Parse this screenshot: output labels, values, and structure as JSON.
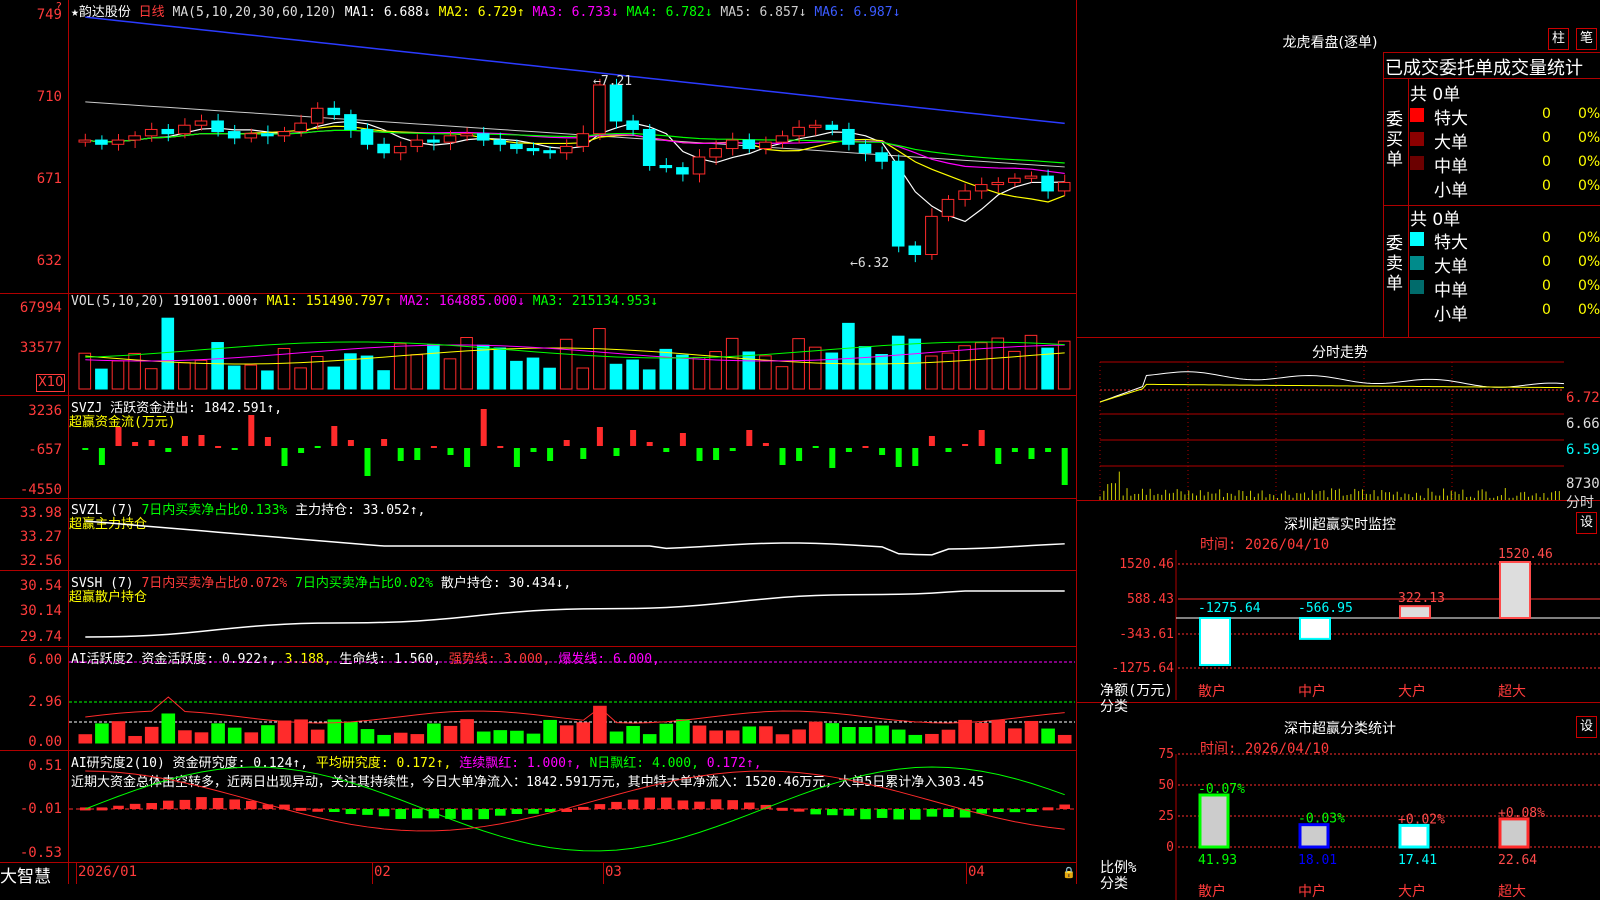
{
  "stock": {
    "name": "★韵达股份",
    "period": "日线"
  },
  "kline": {
    "legend": {
      "ma_label": "MA(5,10,20,30,60,120)",
      "ma1": "MA1: 6.688↓",
      "ma2": "MA2: 6.729↑",
      "ma3": "MA3: 6.733↓",
      "ma4": "MA4: 6.782↓",
      "ma5": "MA5: 6.857↓",
      "ma6": "MA6: 6.987↓"
    },
    "y_ticks": [
      "749",
      "710",
      "671",
      "632"
    ],
    "high_note": "7.21",
    "low_note": "6.32"
  },
  "vol": {
    "label": "VOL(5,10,20)",
    "val": "191001.000↑",
    "ma1": "MA1: 151490.797↑",
    "ma2": "MA2: 164885.000↓",
    "ma3": "MA3: 215134.953↓",
    "y_ticks": [
      "67994",
      "33577"
    ],
    "unit": "X10"
  },
  "svzj": {
    "label": "SVZJ  活跃资金进出: 1842.591↑,",
    "sub": "超赢资金流(万元)",
    "y_ticks": [
      "3236",
      "-657",
      "-4550"
    ]
  },
  "svzl": {
    "label": "SVZL (7)",
    "t1": "7日内买卖净占比0.133%",
    "t2": "主力持仓: 33.052↑,",
    "sub": "超赢主力持仓",
    "y_ticks": [
      "33.98",
      "33.27",
      "32.56"
    ]
  },
  "svsh": {
    "label": "SVSH (7)",
    "t1": "7日内买卖净占比0.072%",
    "t2": "7日内买卖净占比0.02%",
    "t3": "散户持仓: 30.434↓,",
    "sub": "超赢散户持仓",
    "y_ticks": [
      "30.54",
      "30.14",
      "29.74"
    ]
  },
  "ai1": {
    "label": "AI活跃度2",
    "t1": "资金活跃度: 0.922↑,",
    "t2": "3.188,",
    "t3": "生命线: 1.560,",
    "t4": "强势线: 3.000,",
    "t5": "爆发线: 6.000,",
    "y_ticks": [
      "6.00",
      "2.96",
      "0.00"
    ]
  },
  "ai2": {
    "label": "AI研究度2(10)",
    "t1": "资金研究度: 0.124↑,",
    "t2": "平均研究度: 0.172↑,",
    "t3": "连续飘红: 1.000↑,",
    "t4": "N日飘红: 4.000,",
    "t5": "0.172↑,",
    "note": "近期大资金总体由空转多，近两日出现异动，关注其持续性，今日大单净流入：1842.591万元，其中特大单净流入：1520.46万元，大单5日累计净入303.45",
    "y_ticks": [
      "0.51",
      "-0.01",
      "-0.53"
    ]
  },
  "x_axis": {
    "labels": [
      "2026/01",
      "02",
      "03",
      "04"
    ]
  },
  "brand": "大智慧",
  "dragon": {
    "title": "龙虎看盘(逐单)",
    "btn1": "柱",
    "btn2": "笔",
    "tabs": "已成交委托单成交量统计",
    "buy": {
      "side": "委买单",
      "total": "共 0单",
      "rows": [
        {
          "name": "特大",
          "n": "0",
          "p": "0%",
          "color": "#ff0000"
        },
        {
          "name": "大单",
          "n": "0",
          "p": "0%",
          "color": "#8b0000"
        },
        {
          "name": "中单",
          "n": "0",
          "p": "0%",
          "color": "#6b0000"
        },
        {
          "name": "小单",
          "n": "0",
          "p": "0%",
          "color": ""
        }
      ]
    },
    "sell": {
      "side": "委卖单",
      "total": "共 0单",
      "rows": [
        {
          "name": "特大",
          "n": "0",
          "p": "0%",
          "color": "#00ffff"
        },
        {
          "name": "大单",
          "n": "0",
          "p": "0%",
          "color": "#008b8b"
        },
        {
          "name": "中单",
          "n": "0",
          "p": "0%",
          "color": "#006b6b"
        },
        {
          "name": "小单",
          "n": "0",
          "p": "0%",
          "color": ""
        }
      ]
    }
  },
  "intraday": {
    "title": "分时走势",
    "y_ticks": [
      "6.72",
      "6.66",
      "6.59",
      "8730"
    ],
    "unit": "分时"
  },
  "sz_monitor": {
    "title": "深圳超赢实时监控",
    "btn": "设",
    "time": "时间: 2026/04/10",
    "y_ticks": [
      "1520.46",
      "588.43",
      "-343.61",
      "-1275.64"
    ],
    "ylabel": "净额(万元)",
    "xcat": "分类",
    "cats": [
      "散户",
      "中户",
      "大户",
      "超大"
    ],
    "values": [
      "-1275.64",
      "-566.95",
      "322.13",
      "1520.46"
    ]
  },
  "sz_class": {
    "title": "深市超赢分类统计",
    "btn": "设",
    "time": "时间: 2026/04/10",
    "y_ticks": [
      "75",
      "50",
      "25",
      "0"
    ],
    "ylabel": "比例%",
    "xcat": "分类",
    "cats": [
      "散户",
      "中户",
      "大户",
      "超大"
    ],
    "changes": [
      "-0.07%",
      "-0.03%",
      "+0.02%",
      "+0.08%"
    ],
    "values": [
      "41.93",
      "18.01",
      "17.41",
      "22.64"
    ]
  }
}
